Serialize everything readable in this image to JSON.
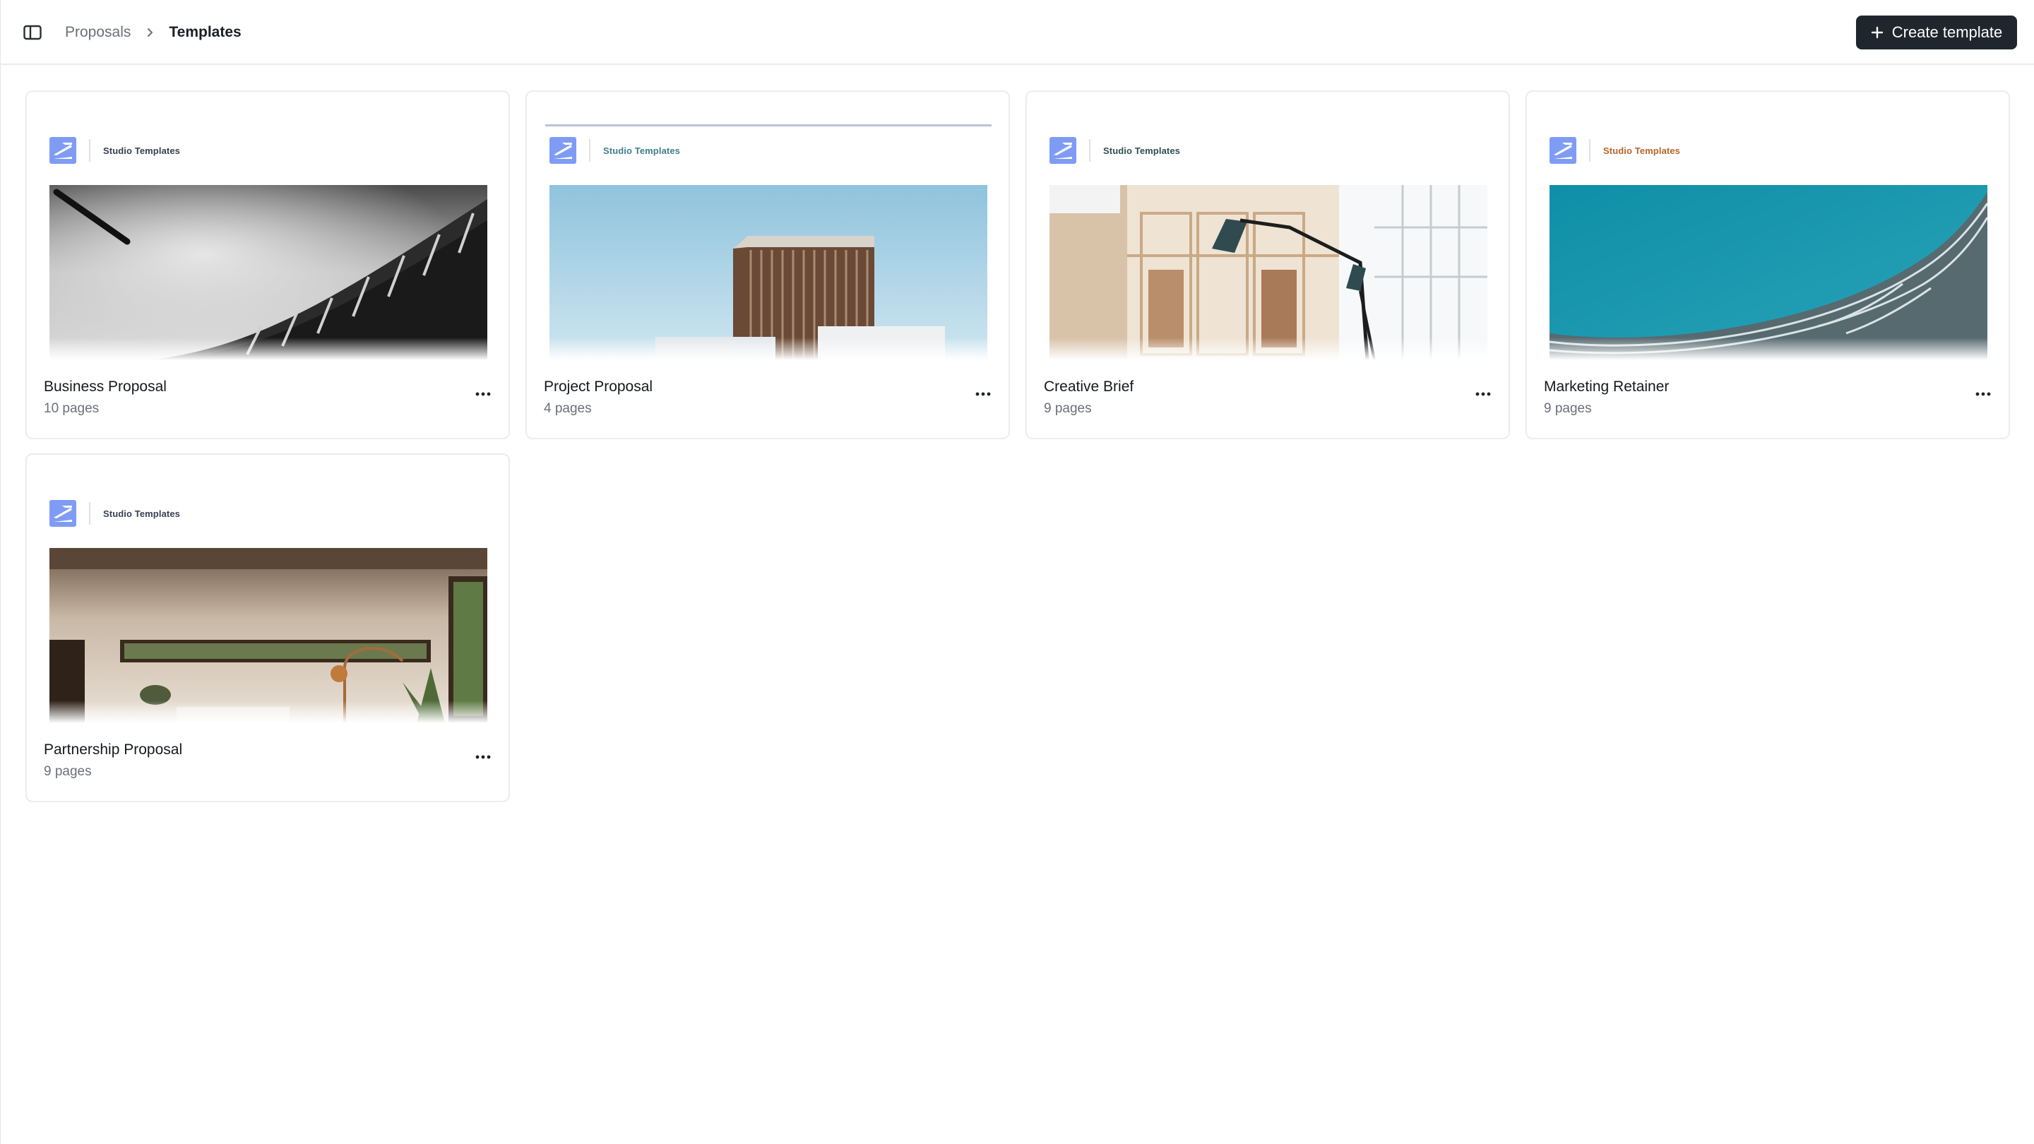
{
  "breadcrumb": {
    "parent": "Proposals",
    "current": "Templates"
  },
  "create_button": {
    "label": "Create template",
    "icon": "plus-icon"
  },
  "colors": {
    "accent_dark": "#1f262e",
    "logo_blue": "#7f9cf5",
    "brand_label_default": "#374151",
    "brand_label_teal": "#3f7f8c",
    "brand_label_orange": "#b8642a"
  },
  "templates": [
    {
      "title": "Business Proposal",
      "pages": "10 pages",
      "brand": "Studio Templates",
      "image": "black-white-curved-building"
    },
    {
      "title": "Project Proposal",
      "pages": "4 pages",
      "brand": "Studio Templates",
      "image": "wooden-slat-building-blue-sky"
    },
    {
      "title": "Creative Brief",
      "pages": "9 pages",
      "brand": "Studio Templates",
      "image": "office-interior-with-lamp"
    },
    {
      "title": "Marketing Retainer",
      "pages": "9 pages",
      "brand": "Studio Templates",
      "image": "teal-sky-wave-facade"
    },
    {
      "title": "Partnership Proposal",
      "pages": "9 pages",
      "brand": "Studio Templates",
      "image": "warm-living-room-interior"
    }
  ]
}
